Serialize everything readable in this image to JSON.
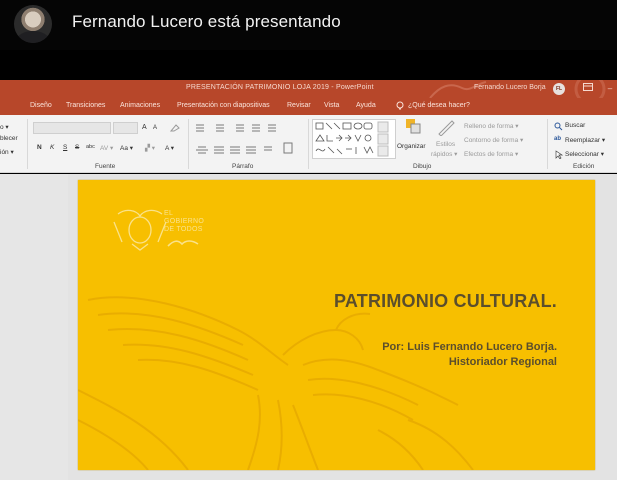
{
  "presenter": {
    "name_text": "Fernando Lucero está presentando"
  },
  "ppt": {
    "window_title": "PRESENTACIÓN PATRIMONIO LOJA 2019  -  PowerPoint",
    "user_name": "Fernando Lucero Borja",
    "user_initials": "FL",
    "tabs": [
      "Diseño",
      "Transiciones",
      "Animaciones",
      "Presentación con diapositivas",
      "Revisar",
      "Vista",
      "Ayuda"
    ],
    "tell_me": "¿Qué desea hacer?",
    "accent_color": "#b7472a"
  },
  "ribbon": {
    "left_cut": [
      "o ▾",
      "blecer",
      "ión ▾"
    ],
    "groups": {
      "fuente": "Fuente",
      "parrafo": "Párrafo",
      "dibujo": "Dibujo",
      "edicion": "Edición"
    },
    "font_format": {
      "bold": "N",
      "italic": "K",
      "underline": "S",
      "strike": "S",
      "spacing": "abc",
      "av": "AV ▾",
      "case": "Aa ▾",
      "grow": "A",
      "shrink": "A"
    },
    "dibujo": {
      "organizar": "Organizar",
      "estilos": "Estilos",
      "rapidos": "rápidos ▾",
      "relleno": "Relleno de forma ▾",
      "contorno": "Contorno de forma ▾",
      "efectos": "Efectos de forma ▾"
    },
    "edicion": {
      "buscar": "Buscar",
      "reemplazar": "Reemplazar ▾",
      "seleccionar": "Seleccionar ▾"
    }
  },
  "slide": {
    "gov_logo_text": "EL\nGOBIERNO\nDE TODOS",
    "title": "PATRIMONIO CULTURAL.",
    "author": "Por: Luis Fernando Lucero Borja.",
    "role": "Historiador Regional",
    "background_color": "#f7bf00"
  }
}
